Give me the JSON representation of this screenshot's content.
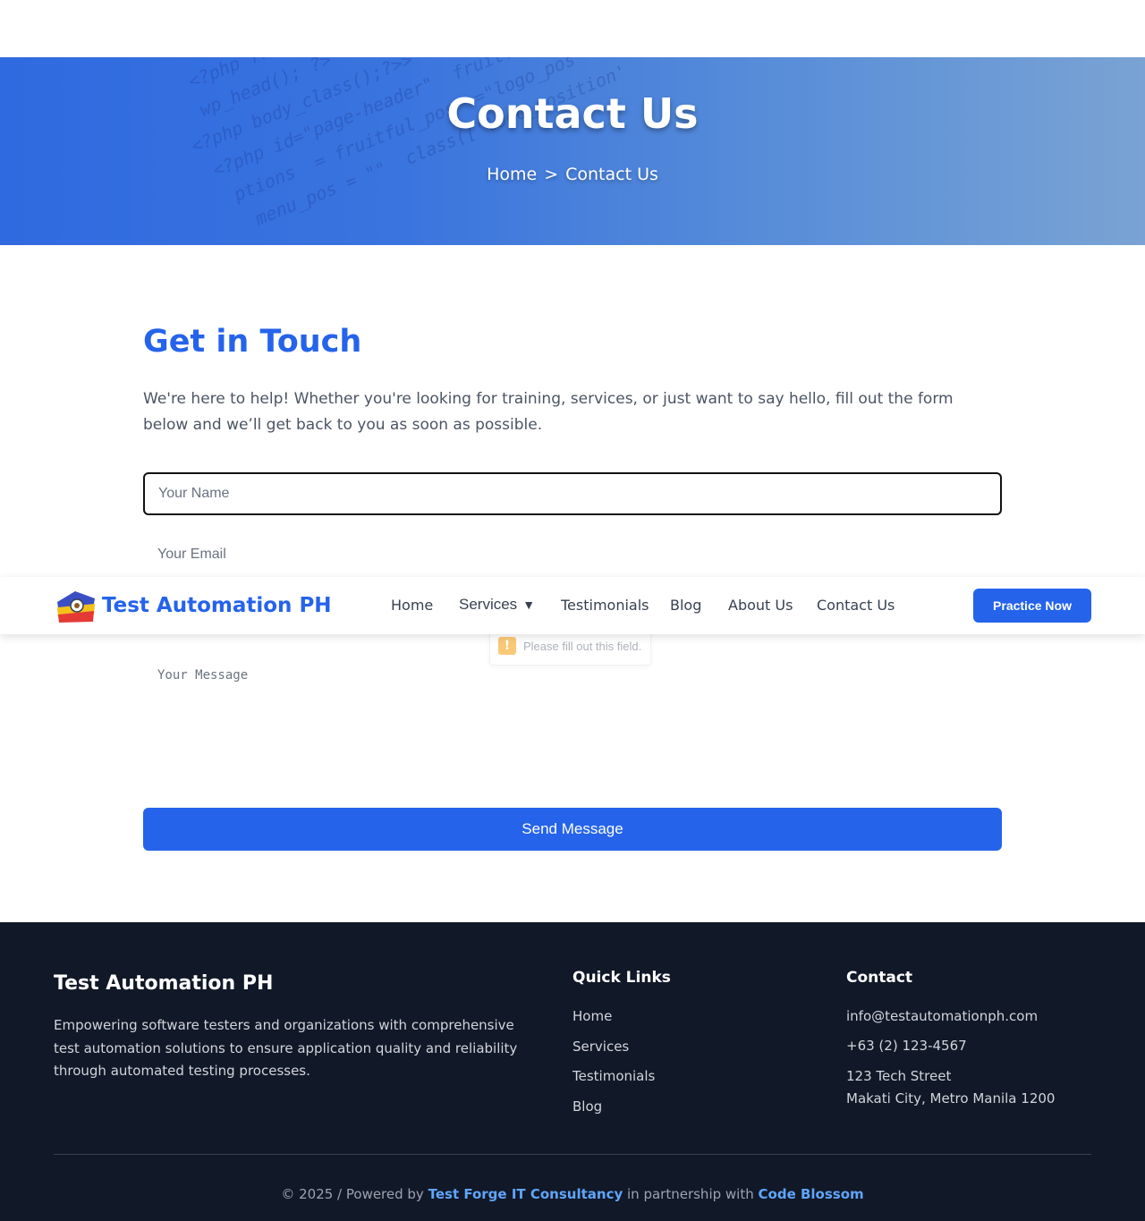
{
  "hero": {
    "title": "Contact Us",
    "breadcrumb_home": "Home",
    "breadcrumb_separator": ">",
    "breadcrumb_current": "Contact Us"
  },
  "main": {
    "heading": "Get in Touch",
    "intro": "We're here to help! Whether you're looking for training, services, or just want to say hello, fill out the form below and we’ll get back to you as soon as possible.",
    "form": {
      "name_placeholder": "Your Name",
      "email_placeholder": "Your Email",
      "message_placeholder": "Your Message",
      "submit_label": "Send Message"
    },
    "validation_tooltip": "Please fill out this field."
  },
  "navbar": {
    "brand": "Test Automation PH",
    "links": [
      "Home",
      "Services",
      "Testimonials",
      "Blog",
      "About Us",
      "Contact Us"
    ],
    "services_caret": "▼",
    "cta": "Practice Now"
  },
  "footer": {
    "brand": "Test Automation PH",
    "description": "Empowering software testers and organizations with comprehensive test automation solutions to ensure application quality and reliability through automated testing processes.",
    "quick_links_heading": "Quick Links",
    "quick_links": [
      "Home",
      "Services",
      "Testimonials",
      "Blog"
    ],
    "contact_heading": "Contact",
    "email": "info@testautomationph.com",
    "phone": "+63 (2) 123-4567",
    "address_line1": "123 Tech Street",
    "address_line2": "Makati City, Metro Manila 1200",
    "copyright_prefix": "© 2025 / Powered by",
    "powered_by": "Test Forge IT Consultancy",
    "partnership_text": "in partnership with",
    "partner": "Code Blossom"
  },
  "colors": {
    "accent": "#2563eb",
    "footer_bg": "#111827",
    "warning": "#f59e0b"
  }
}
